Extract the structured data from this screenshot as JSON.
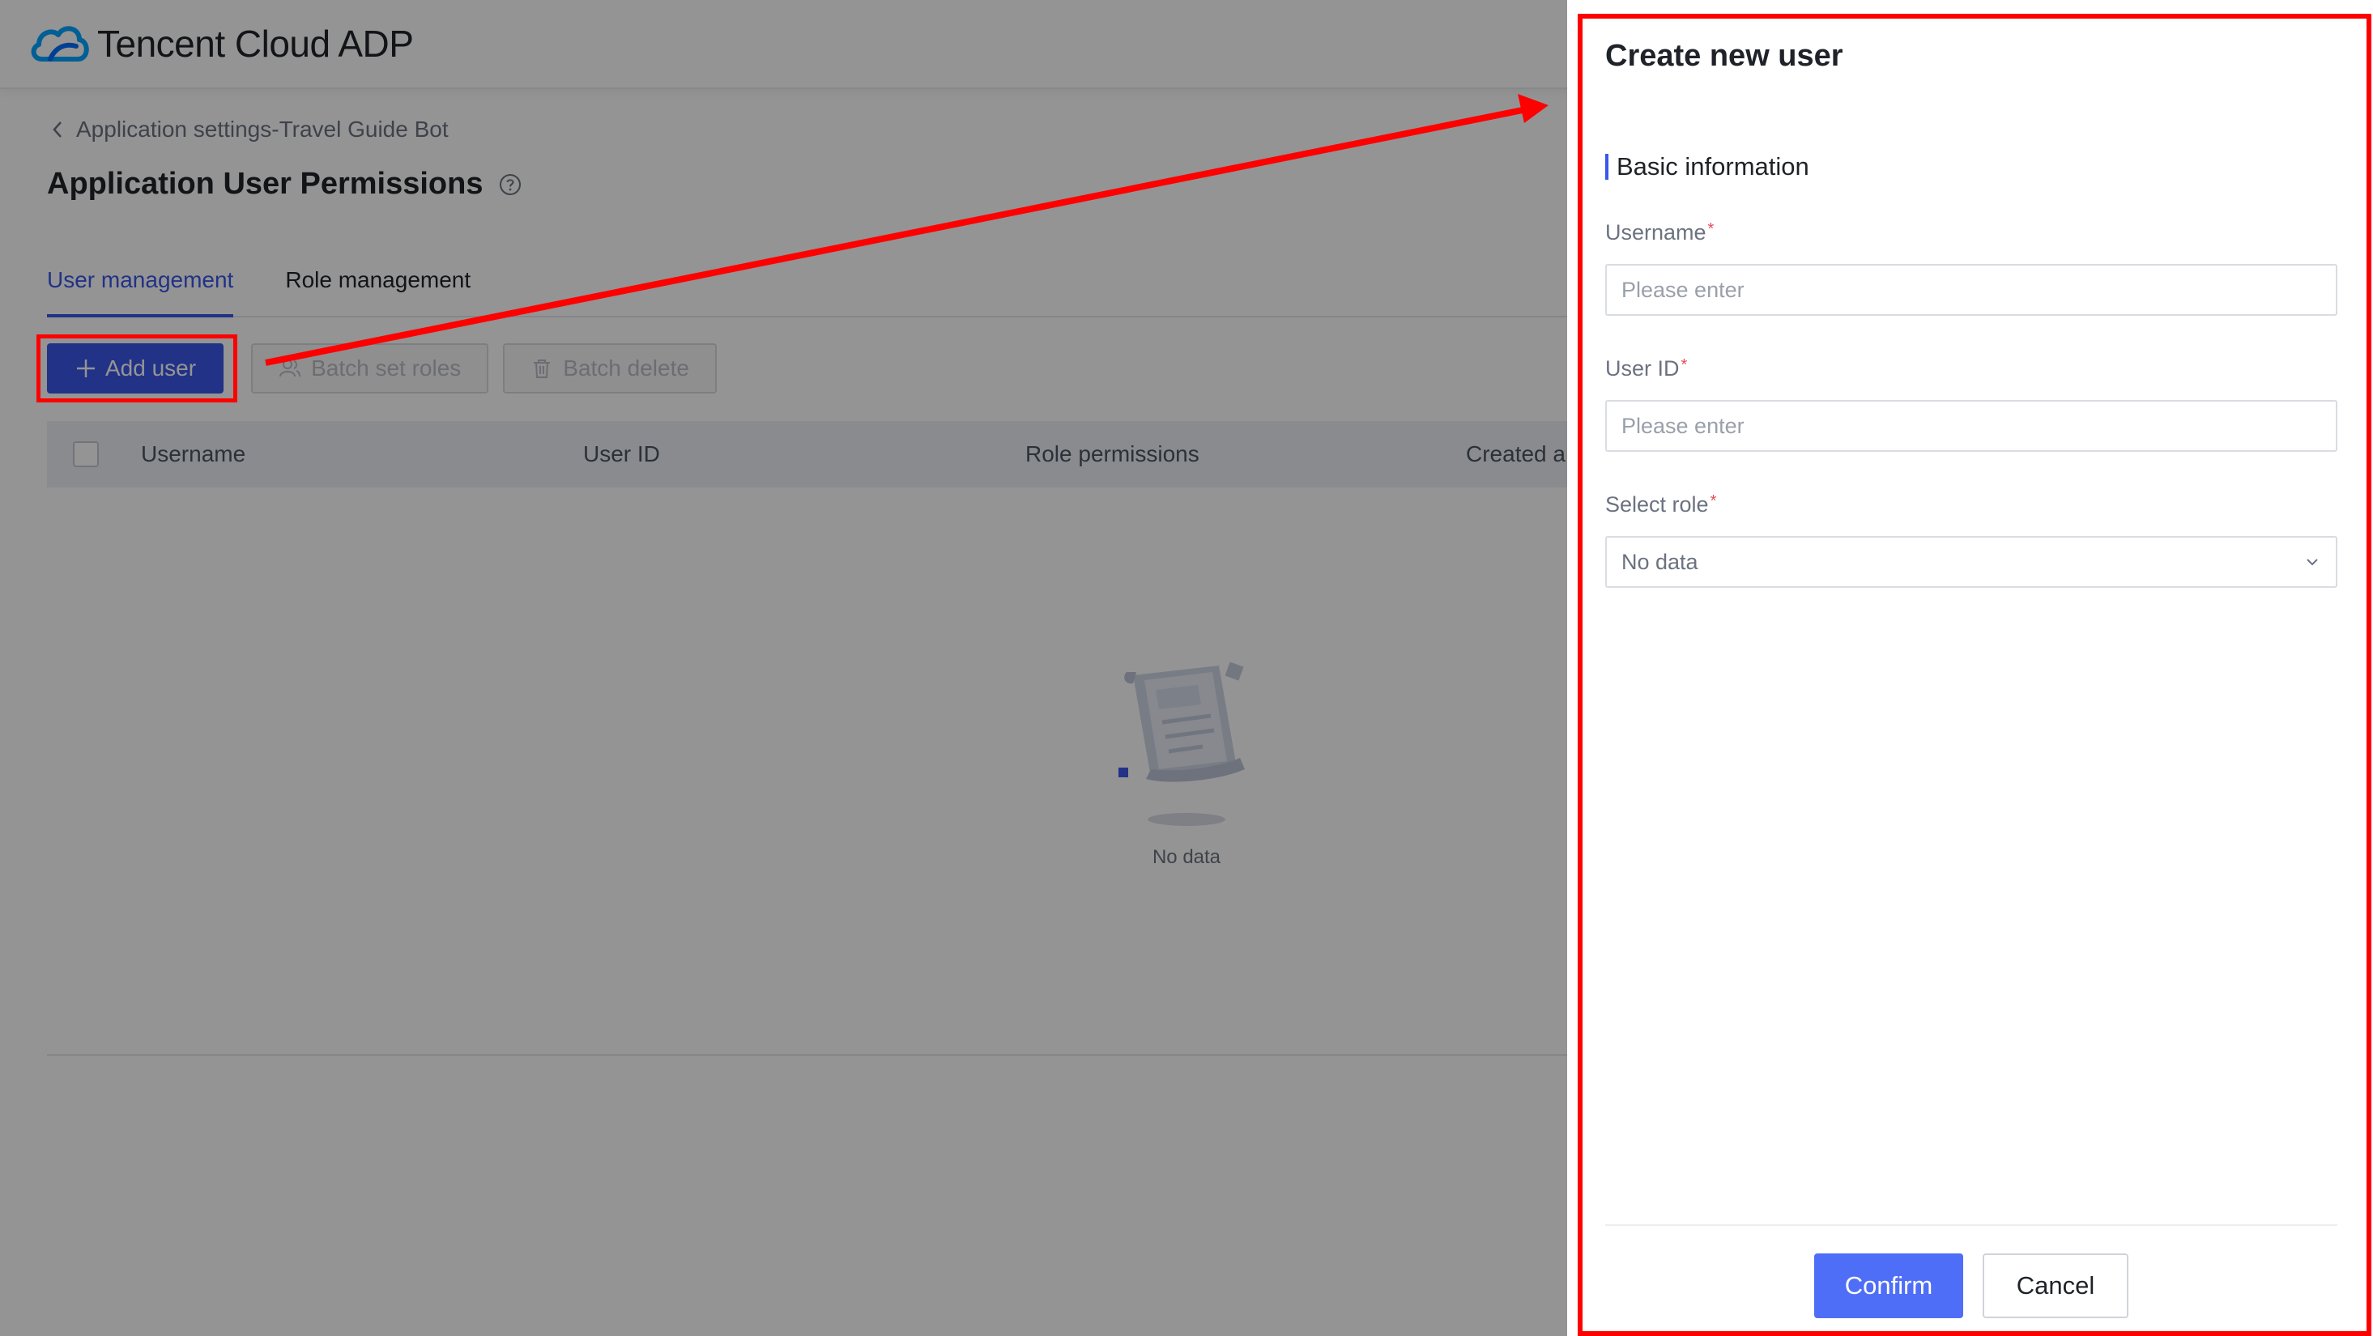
{
  "header": {
    "brand": "Tencent Cloud  ADP",
    "logo_icon": "cloud-logo-icon"
  },
  "breadcrumb": {
    "back_icon": "chevron-left-icon",
    "label": "Application settings-Travel Guide Bot"
  },
  "page": {
    "title": "Application User Permissions",
    "help_icon": "question-circle-icon"
  },
  "tabs": [
    {
      "label": "User management",
      "active": true
    },
    {
      "label": "Role management",
      "active": false
    }
  ],
  "toolbar": {
    "add_user": "Add user",
    "batch_set_roles": "Batch set roles",
    "batch_delete": "Batch delete"
  },
  "table": {
    "columns": [
      "Username",
      "User ID",
      "Role permissions",
      "Created a"
    ]
  },
  "empty_state": {
    "text": "No data",
    "icon": "empty-document-icon"
  },
  "drawer": {
    "title": "Create new user",
    "section_title": "Basic information",
    "fields": [
      {
        "label": "Username",
        "required_mark": "*",
        "placeholder": "Please enter",
        "value": ""
      },
      {
        "label": "User ID",
        "required_mark": "*",
        "placeholder": "Please enter",
        "value": ""
      }
    ],
    "role": {
      "label": "Select role",
      "required_mark": "*",
      "value": "No data"
    },
    "confirm": "Confirm",
    "cancel": "Cancel"
  },
  "colors": {
    "primary": "#3a57e8",
    "confirm": "#4f6ef7",
    "annotation": "#ff0000",
    "required": "#e34d59"
  }
}
